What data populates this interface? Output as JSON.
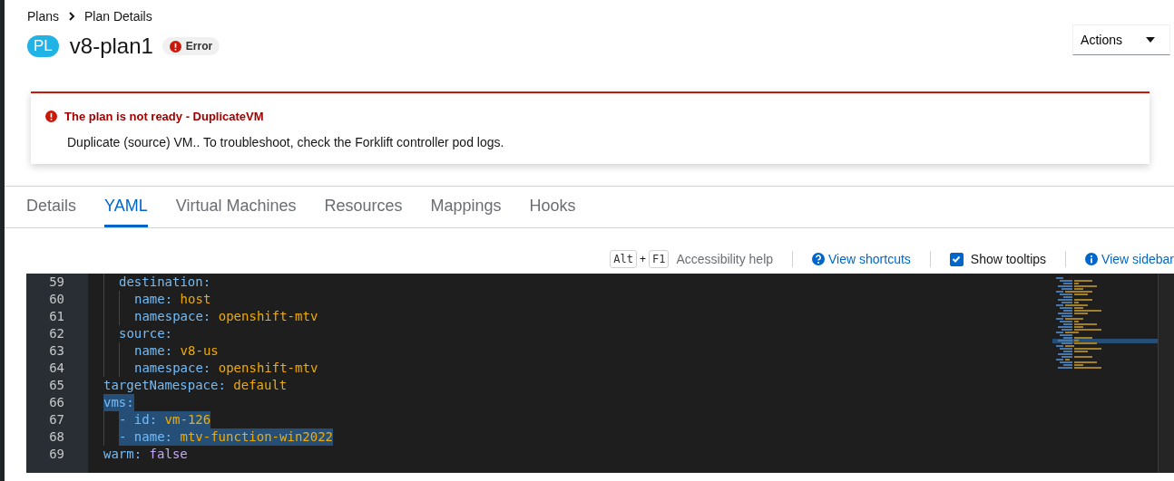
{
  "breadcrumb": [
    {
      "label": "Plans"
    },
    {
      "label": "Plan Details"
    }
  ],
  "header": {
    "badge": "PL",
    "title": "v8-plan1",
    "status": {
      "label": "Error",
      "kind": "error"
    },
    "actions": "Actions"
  },
  "alert": {
    "kind": "danger",
    "title": "The plan is not ready - DuplicateVM",
    "message": "Duplicate (source) VM.. To troubleshoot, check the Forklift controller pod logs."
  },
  "tabs": [
    {
      "label": "Details",
      "selected": false
    },
    {
      "label": "YAML",
      "selected": true
    },
    {
      "label": "Virtual Machines",
      "selected": false
    },
    {
      "label": "Resources",
      "selected": false
    },
    {
      "label": "Mappings",
      "selected": false
    },
    {
      "label": "Hooks",
      "selected": false
    }
  ],
  "toolbar": {
    "keys": [
      "Alt",
      "F1"
    ],
    "plus": "+",
    "accessibility": "Accessibility help",
    "shortcuts": "View shortcuts",
    "tooltips": {
      "label": "Show tooltips",
      "checked": true
    },
    "sidebar": "View sidebar"
  },
  "editor": {
    "lines": [
      {
        "number": "59",
        "key": "    destination:",
        "selected": false
      },
      {
        "number": "60",
        "key": "      name:",
        "value": "host",
        "kind": "string",
        "selected": false
      },
      {
        "number": "61",
        "key": "      namespace:",
        "value": "openshift-mtv",
        "kind": "string",
        "selected": false
      },
      {
        "number": "62",
        "key": "    source:",
        "selected": false
      },
      {
        "number": "63",
        "key": "      name:",
        "value": "v8-us",
        "kind": "string",
        "selected": false
      },
      {
        "number": "64",
        "key": "      namespace:",
        "value": "openshift-mtv",
        "kind": "string",
        "selected": false
      },
      {
        "number": "65",
        "key": "  targetNamespace:",
        "value": "default",
        "kind": "string",
        "selected": false
      },
      {
        "number": "66",
        "key": "  vms:",
        "selected": true
      },
      {
        "number": "67",
        "key": "    - id:",
        "value": "vm-126",
        "kind": "string",
        "selected": true
      },
      {
        "number": "68",
        "key": "    - name:",
        "value": "mtv-function-win2022",
        "kind": "string",
        "selected": true
      },
      {
        "number": "69",
        "key": "  warm:",
        "value": "false",
        "kind": "boolean",
        "selected": false
      }
    ]
  }
}
